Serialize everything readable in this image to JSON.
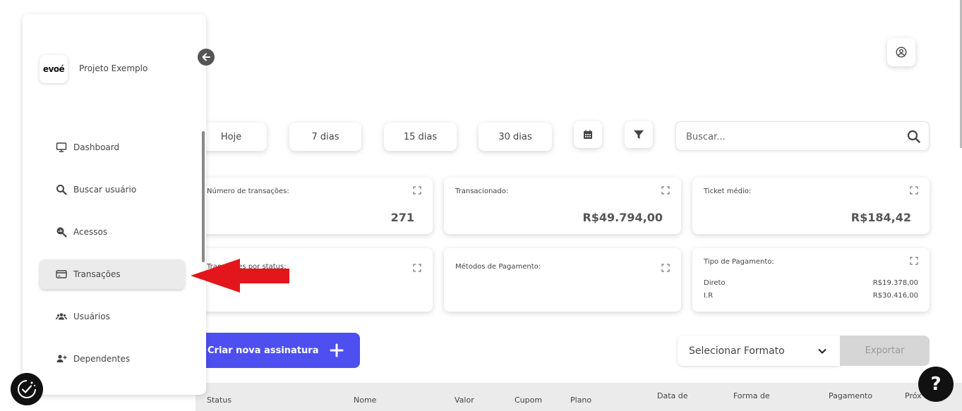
{
  "brand": {
    "logo_text": "evoé",
    "project_name": "Projeto Exemplo"
  },
  "sidebar": {
    "items": [
      {
        "label": "Dashboard",
        "icon": "monitor-icon"
      },
      {
        "label": "Buscar usuário",
        "icon": "search-icon"
      },
      {
        "label": "Acessos",
        "icon": "search-chart-icon"
      },
      {
        "label": "Transações",
        "icon": "credit-card-icon",
        "active": true
      },
      {
        "label": "Usuários",
        "icon": "users-icon"
      },
      {
        "label": "Dependentes",
        "icon": "user-plus-icon"
      }
    ]
  },
  "filters": {
    "periods": [
      "Hoje",
      "7 dias",
      "15 dias",
      "30 dias"
    ],
    "search_placeholder": "Buscar..."
  },
  "metrics": [
    {
      "label": "Número de transações:",
      "value": "271"
    },
    {
      "label": "Transacionado:",
      "value": "R$49.794,00"
    },
    {
      "label": "Ticket médio:",
      "value": "R$184,42"
    },
    {
      "label": "Transações por status:",
      "value": ""
    },
    {
      "label": "Métodos de Pagamento:",
      "value": ""
    },
    {
      "label": "Tipo de Pagamento:",
      "rows": [
        {
          "name": "Direto",
          "value": "R$19.378,00"
        },
        {
          "name": "I.R",
          "value": "R$30.416,00"
        }
      ]
    }
  ],
  "actions": {
    "create_label": "Criar nova assinatura",
    "format_label": "Selecionar Formato",
    "export_label": "Exportar"
  },
  "table": {
    "columns": [
      "Status",
      "Nome",
      "Valor",
      "Cupom",
      "Plano",
      "Data de",
      "Forma de",
      "Pagamento",
      "Próx"
    ]
  },
  "help": {
    "label": "?"
  },
  "colors": {
    "accent": "#4d4ff0",
    "arrow": "#e3161b",
    "active_bg": "#ebebeb"
  }
}
